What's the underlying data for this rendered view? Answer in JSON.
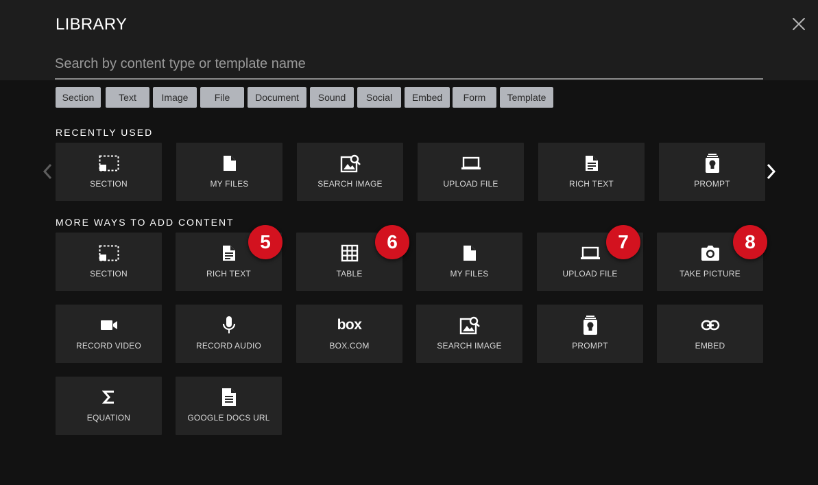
{
  "header": {
    "title": "LIBRARY",
    "search_placeholder": "Search by content type or template name"
  },
  "filters": [
    "Section",
    "Text",
    "Image",
    "File",
    "Document",
    "Sound",
    "Social",
    "Embed",
    "Form",
    "Template"
  ],
  "recently_used": {
    "label": "RECENTLY USED",
    "items": [
      {
        "label": "SECTION",
        "icon": "section-icon"
      },
      {
        "label": "MY FILES",
        "icon": "file-icon"
      },
      {
        "label": "SEARCH IMAGE",
        "icon": "image-search-icon"
      },
      {
        "label": "UPLOAD FILE",
        "icon": "laptop-icon"
      },
      {
        "label": "RICH TEXT",
        "icon": "document-icon"
      },
      {
        "label": "PROMPT",
        "icon": "prompt-icon"
      }
    ]
  },
  "more_ways": {
    "label": "MORE WAYS TO ADD CONTENT",
    "items": [
      {
        "label": "SECTION",
        "icon": "section-icon"
      },
      {
        "label": "RICH TEXT",
        "icon": "document-icon"
      },
      {
        "label": "TABLE",
        "icon": "table-icon"
      },
      {
        "label": "MY FILES",
        "icon": "file-icon"
      },
      {
        "label": "UPLOAD FILE",
        "icon": "laptop-icon"
      },
      {
        "label": "TAKE PICTURE",
        "icon": "camera-icon"
      },
      {
        "label": "RECORD VIDEO",
        "icon": "video-icon"
      },
      {
        "label": "RECORD AUDIO",
        "icon": "microphone-icon"
      },
      {
        "label": "BOX.COM",
        "icon": "box-logo-icon",
        "logo_text": "box"
      },
      {
        "label": "SEARCH IMAGE",
        "icon": "image-search-icon"
      },
      {
        "label": "PROMPT",
        "icon": "prompt-icon"
      },
      {
        "label": "EMBED",
        "icon": "link-icon"
      },
      {
        "label": "EQUATION",
        "icon": "sigma-icon"
      },
      {
        "label": "GOOGLE DOCS URL",
        "icon": "google-doc-icon"
      }
    ]
  },
  "badges": [
    "5",
    "6",
    "7",
    "8"
  ],
  "colors": {
    "badge": "#d3121f",
    "chip": "#b2b5bb",
    "tile": "#242424",
    "header": "#1d1d1d",
    "background": "#121212"
  }
}
